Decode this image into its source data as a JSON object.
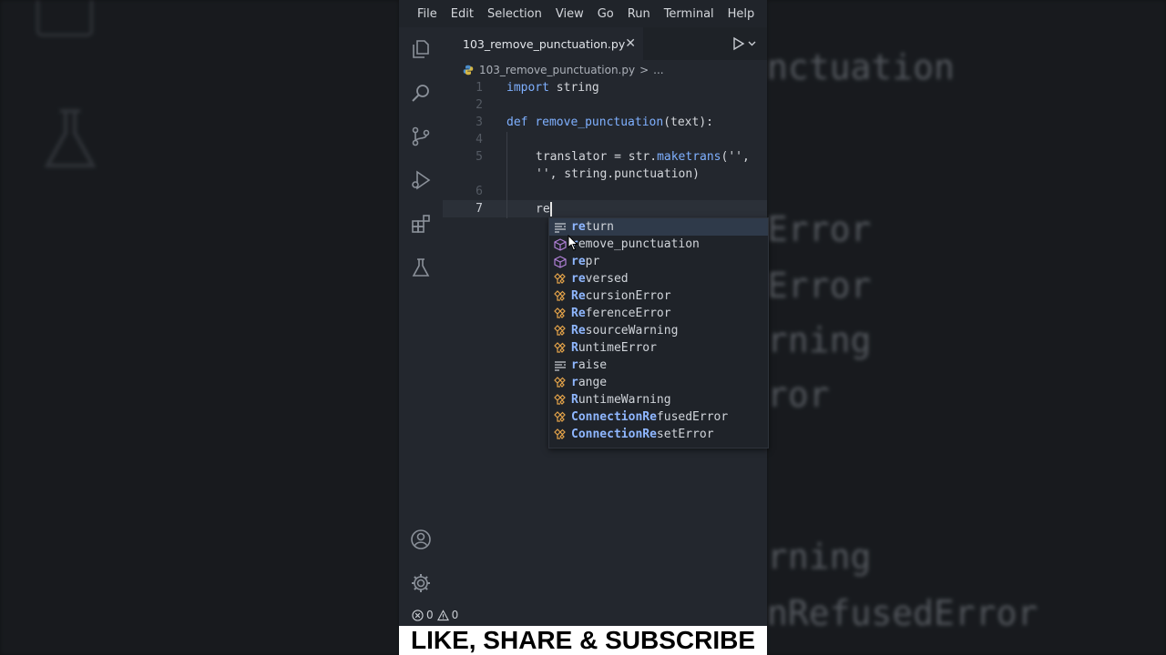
{
  "menu": [
    "File",
    "Edit",
    "Selection",
    "View",
    "Go",
    "Run",
    "Terminal",
    "Help"
  ],
  "tab": {
    "filename": "103_remove_punctuation.py",
    "close": "✕"
  },
  "breadcrumb": {
    "file": "103_remove_punctuation.py",
    "sep": ">",
    "more": "..."
  },
  "code_lines": [
    {
      "n": "1",
      "text": ""
    },
    {
      "n": "2",
      "text": ""
    },
    {
      "n": "3",
      "text": ""
    },
    {
      "n": "4",
      "text": ""
    },
    {
      "n": "5",
      "text": ""
    },
    {
      "n": "",
      "text": ""
    },
    {
      "n": "6",
      "text": ""
    },
    {
      "n": "7",
      "text": "re"
    }
  ],
  "code": {
    "import_kw": "import",
    "import_mod": "string",
    "def_kw": "def",
    "def_name": "remove_punctuation",
    "def_sig": "(text):",
    "l5a": "translator = str.",
    "l5b": "maketrans",
    "l5c": "('',",
    "l5d": "'', string.punctuation)",
    "l7": "re"
  },
  "suggestions": [
    {
      "match": "re",
      "rest": "turn",
      "kind": "keyword"
    },
    {
      "match": "r",
      "rest": "emove_punctuation",
      "kind": "function"
    },
    {
      "match": "re",
      "rest": "pr",
      "kind": "function"
    },
    {
      "match": "re",
      "rest": "versed",
      "kind": "class"
    },
    {
      "match": "Re",
      "rest": "cursionError",
      "kind": "class"
    },
    {
      "match": "Re",
      "rest": "ferenceError",
      "kind": "class"
    },
    {
      "match": "Re",
      "rest": "sourceWarning",
      "kind": "class"
    },
    {
      "match": "R",
      "rest": "untimeError",
      "kind": "class"
    },
    {
      "match": "r",
      "rest": "aise",
      "kind": "keyword"
    },
    {
      "match": "r",
      "rest": "ange",
      "kind": "class"
    },
    {
      "match": "R",
      "rest": "untimeWarning",
      "kind": "class"
    },
    {
      "match": "ConnectionRe",
      "rest": "fusedError",
      "kind": "class"
    },
    {
      "match": "ConnectionRe",
      "rest": "setError",
      "kind": "class"
    }
  ],
  "status": {
    "errors": "0",
    "warnings": "0"
  },
  "banner": "LIKE, SHARE & SUBSCRIBE",
  "ghost_right": [
    "nctuation",
    "Error",
    "Error",
    "rning",
    "ror",
    "rning",
    "nRefusedError"
  ],
  "colors": {
    "accent": "#007acc",
    "icon_class": "#e5a44a",
    "icon_func": "#b180d7"
  }
}
